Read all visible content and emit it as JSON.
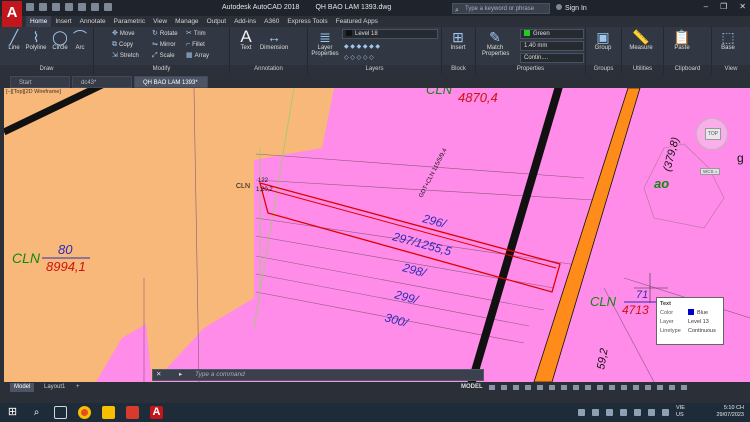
{
  "app": {
    "logo": "A",
    "title": "Autodesk AutoCAD 2018",
    "document": "QH BAO LAM 1393.dwg",
    "search_placeholder": "Type a keyword or phrase",
    "sign_in": "Sign In",
    "window_controls": [
      "–",
      "❐",
      "✕"
    ]
  },
  "ribbon_tabs": [
    "Home",
    "Insert",
    "Annotate",
    "Parametric",
    "View",
    "Manage",
    "Output",
    "Add-ins",
    "A360",
    "Express Tools",
    "Featured Apps"
  ],
  "ribbon": {
    "draw": {
      "title": "Draw",
      "line": "Line",
      "polyline": "Polyline",
      "circle": "Circle",
      "arc": "Arc"
    },
    "modify": {
      "title": "Modify",
      "move": "Move",
      "rotate": "Rotate",
      "trim": "Trim",
      "copy": "Copy",
      "mirror": "Mirror",
      "fillet": "Fillet",
      "stretch": "Stretch",
      "scale": "Scale",
      "array": "Array"
    },
    "annotation": {
      "title": "Annotation",
      "text": "Text",
      "dimension": "Dimension"
    },
    "layers": {
      "title": "Layers",
      "layer_properties": "Layer Properties",
      "current_layer": "Level 18"
    },
    "block": {
      "title": "Block",
      "insert": "Insert"
    },
    "properties": {
      "title": "Properties",
      "match": "Match Properties",
      "color": "Green",
      "lineweight": "1.40 mm",
      "linetype": "Contin...."
    },
    "groups": {
      "title": "Groups",
      "group": "Group"
    },
    "utilities": {
      "title": "Utilities",
      "measure": "Measure"
    },
    "clipboard": {
      "title": "Clipboard",
      "paste": "Paste"
    },
    "view": {
      "title": "View",
      "base": "Base"
    }
  },
  "doc_tabs": [
    "Start",
    "dc43*",
    "QH BAO LAM 1393*"
  ],
  "viewport_label": "[–][Top][2D Wireframe]",
  "drawing": {
    "labels": {
      "cln_top": "CLN",
      "cln_top_num": "4870,4",
      "cln_left": "CLN",
      "cln_left_top": "80",
      "cln_left_bottom": "8994,1",
      "cln_small": "CLN",
      "cln_small_top": "122",
      "cln_small_bottom": "1,20,2",
      "road_label": "GDT+CLN 115/5/9,4",
      "lot_296": "296/",
      "lot_297": "297/1255,5",
      "lot_298": "298/",
      "lot_299": "299/",
      "lot_300": "300/",
      "cln_right": "CLN",
      "cln_right_top": "71",
      "cln_right_bottom": "4713",
      "side_num": "(379,8)",
      "ao": "ao",
      "bottom_num": "59,2",
      "edge_g": "g"
    }
  },
  "command_line": {
    "placeholder": "Type a command",
    "close": "✕",
    "prompt_icon": "▸"
  },
  "tooltip": {
    "title": "Text",
    "rows": [
      {
        "key": "Color",
        "value": "Blue",
        "swatch": "#0000cc"
      },
      {
        "key": "Layer",
        "value": "Level 13"
      },
      {
        "key": "Linetype",
        "value": "Continuous"
      }
    ]
  },
  "viewcube": {
    "top_label": "TOP",
    "wcs": "WCS ="
  },
  "layout_tabs": [
    "Model",
    "Layout1",
    "+"
  ],
  "status": {
    "model": "MODEL"
  },
  "taskbar": {
    "lang": [
      "VIE",
      "US"
    ],
    "time": "5:10 CH",
    "date": "29/07/2023"
  },
  "colors": {
    "background_magenta": "#ff8ce8",
    "parcel_orange": "#f8b87a",
    "road_orange": "#ff8c1a",
    "line_red": "#e00000",
    "text_blue": "#2c2cb8",
    "text_red": "#d01010",
    "text_green": "#118811"
  }
}
